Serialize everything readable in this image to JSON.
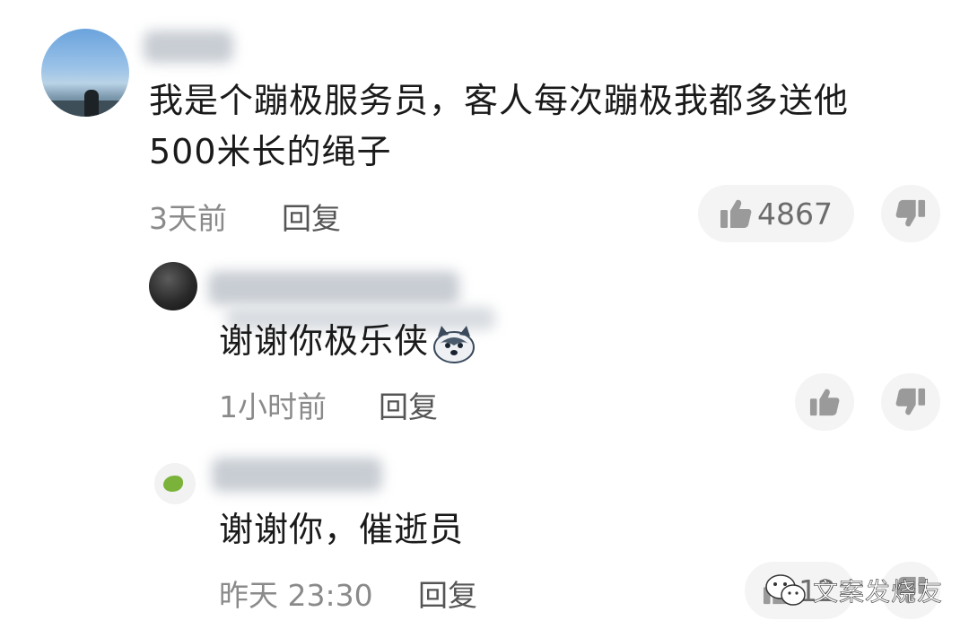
{
  "comments": [
    {
      "text_line1": "我是个蹦极服务员，客人每次蹦极我都多送他",
      "text_line2": "500米长的绳子",
      "time": "3天前",
      "reply_label": "回复",
      "like_count": "4867"
    }
  ],
  "replies": [
    {
      "text": "谢谢你极乐侠",
      "emoji": "husky-emoji",
      "time": "1小时前",
      "reply_label": "回复"
    },
    {
      "text": "谢谢你，催逝员",
      "time": "昨天 23:30",
      "reply_label": "回复",
      "like_count": "12"
    }
  ],
  "watermark": {
    "text": "文案发烧友",
    "icon": "wechat-icon"
  },
  "colors": {
    "text": "#1a1a1a",
    "meta": "#8a8a8a",
    "pill_bg": "#f4f4f4",
    "icon": "#9a9a9a"
  }
}
